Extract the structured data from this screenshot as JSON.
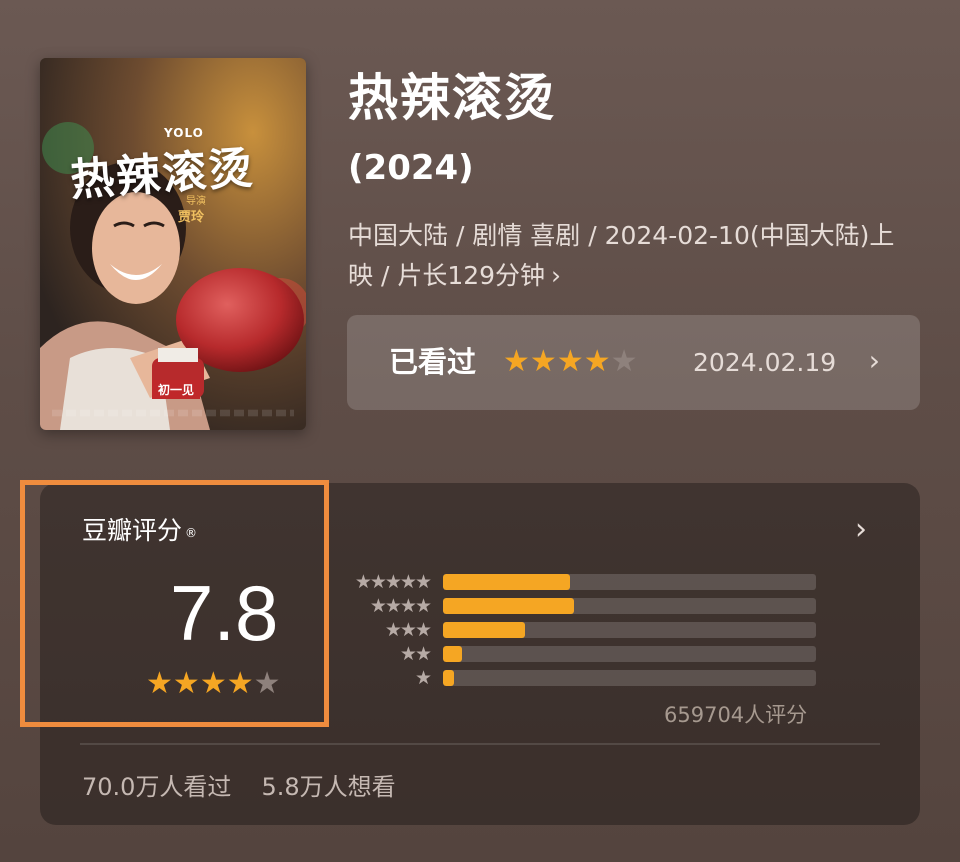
{
  "poster": {
    "title_art": "热辣滚烫",
    "yolo": "YOLO",
    "director_role": "导演",
    "director_name": "贾玲",
    "release_tag": "初一见"
  },
  "movie": {
    "title": "热辣滚烫",
    "year": "(2024)",
    "meta": "中国大陆 / 剧情 喜剧 / 2024-02-10(中国大陆)上映 / 片长129分钟",
    "meta_chevron": "›"
  },
  "watched": {
    "label": "已看过",
    "stars_filled": 4,
    "stars_total": 5,
    "date": "2024.02.19",
    "chevron": "›"
  },
  "rating": {
    "label": "豆瓣评分",
    "registered": "®",
    "score": "7.8",
    "stars_filled": 4,
    "stars_total": 5,
    "chevron": "›",
    "count": "659704人评分",
    "distribution": [
      {
        "stars": "★★★★★",
        "fraction": 0.34
      },
      {
        "stars": "★★★★",
        "fraction": 0.35
      },
      {
        "stars": "★★★",
        "fraction": 0.22
      },
      {
        "stars": "★★",
        "fraction": 0.05
      },
      {
        "stars": "★",
        "fraction": 0.03
      }
    ]
  },
  "stats": {
    "watched": "70.0万人看过",
    "want": "5.8万人想看"
  },
  "colors": {
    "accent_star": "#f5a623",
    "highlight_border": "#ef8c3e"
  },
  "icons": {
    "chevron": "chevron-right-icon",
    "star": "star-icon"
  }
}
